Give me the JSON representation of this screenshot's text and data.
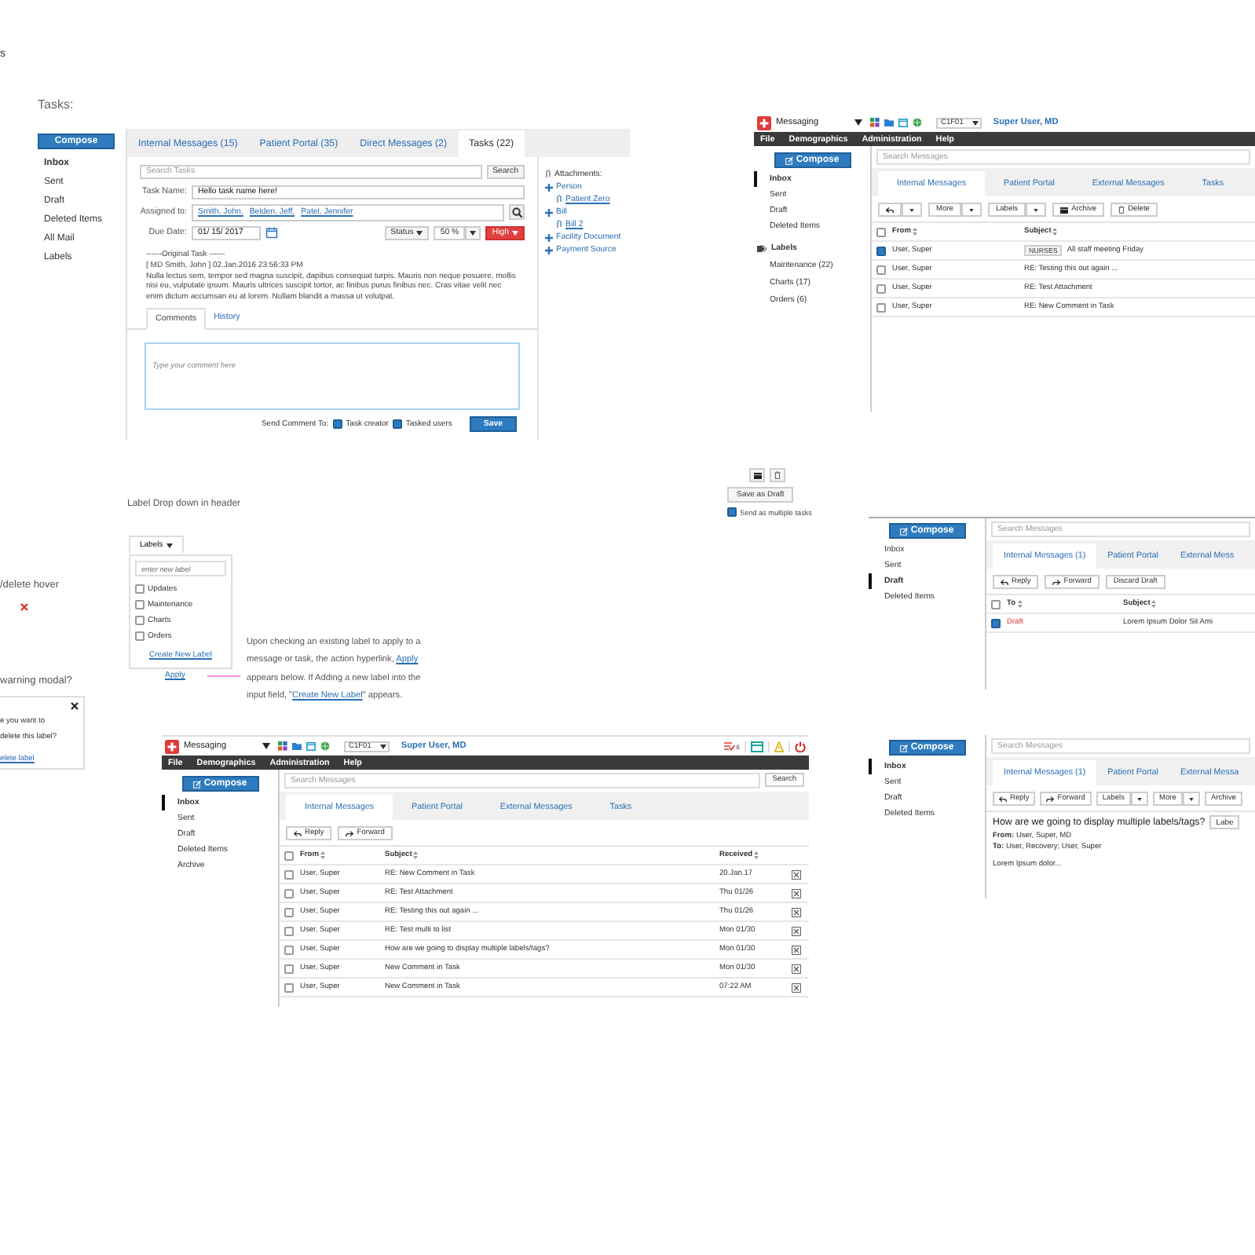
{
  "fragment_top": "s",
  "tasks": {
    "heading": "Tasks:",
    "compose": "Compose",
    "folders": [
      {
        "label": "Inbox",
        "selected": true
      },
      {
        "label": "Sent",
        "selected": false
      },
      {
        "label": "Draft",
        "selected": false
      },
      {
        "label": "Deleted Items",
        "selected": false
      },
      {
        "label": "All Mail",
        "selected": false
      },
      {
        "label": "Labels",
        "selected": false
      }
    ],
    "tabs": [
      {
        "label": "Internal Messages (15)",
        "selected": false
      },
      {
        "label": "Patient Portal (35)",
        "selected": false
      },
      {
        "label": "Direct Messages (2)",
        "selected": false
      },
      {
        "label": "Tasks (22)",
        "selected": true
      }
    ],
    "search": {
      "placeholder": "Search Tasks",
      "button": "Search"
    },
    "task_name": {
      "label": "Task Name:",
      "value": "Hello task name here!"
    },
    "assigned": {
      "label": "Assigned to:",
      "people": [
        "Smith, John,",
        "Belden, Jeff,",
        "Patel, Jennifer"
      ]
    },
    "due_date": {
      "label": "Due Date:",
      "value": "01/ 15/ 2017"
    },
    "status": "Status",
    "percent": "50 %",
    "priority": "High",
    "original": {
      "title": "------Original Task ------",
      "meta": "[ MD Smith, John ]  02.Jan.2016 23:56:33 PM",
      "body": "Nulla lectus sem, tempor sed magna suscipit, dapibus consequat turpis. Mauris non neque posuere, mollis nisi eu, vulputate ipsum. Mauris ultrices suscipit tortor, ac finibus purus finibus nec. Cras vitae velit nec enim dictum accumsan eu at lorem. Nullam blandit a massa ut volutpat."
    },
    "comment_tabs": [
      {
        "label": "Comments",
        "selected": true
      },
      {
        "label": "History",
        "selected": false
      }
    ],
    "comment": {
      "placeholder": "Type your comment here"
    },
    "send_to": {
      "label": "Send Comment To:",
      "options": [
        {
          "label": "Task creator",
          "checked": true
        },
        {
          "label": "Tasked users",
          "checked": true
        }
      ]
    },
    "save": "Save",
    "attachments": {
      "heading": "Attachments:",
      "items": [
        {
          "label": "Person",
          "children": [
            {
              "label": "Patient Zero"
            }
          ]
        },
        {
          "label": "Bill",
          "children": [
            {
              "label": "Bill 2"
            }
          ]
        },
        {
          "label": "Facility Document"
        },
        {
          "label": "Payment Source"
        }
      ]
    }
  },
  "label_dropdown": {
    "caption": "Label Drop down in header",
    "button": "Labels",
    "input": {
      "placeholder": "enter new label"
    },
    "options": [
      {
        "label": "Updates",
        "checked": false
      },
      {
        "label": "Maintenance",
        "checked": false
      },
      {
        "label": "Charts",
        "checked": false
      },
      {
        "label": "Orders",
        "checked": false
      }
    ],
    "create_link": "Create New Label",
    "apply_link": "Apply",
    "note": [
      {
        "kind": "text",
        "text": "Upon checking an existing label to apply to a message or task, the action hyperlink, "
      },
      {
        "kind": "link",
        "text": "Apply"
      },
      {
        "kind": "text",
        "text": " appears below. If Adding a new label into the input field, \""
      },
      {
        "kind": "link",
        "text": "Create New Label"
      },
      {
        "kind": "text",
        "text": "\" appears."
      }
    ]
  },
  "delete_hover": {
    "caption": "/delete hover"
  },
  "warning": {
    "caption": "warning modal?",
    "lines": [
      "e you want to",
      "delete this label?"
    ],
    "link": "elete label"
  },
  "draft_controls": {
    "save_draft": "Save as Draft",
    "multiple": {
      "label": "Send as multiple tasks",
      "checked": true
    }
  },
  "windows": [
    {
      "header": {
        "app": "Messaging",
        "clinic": "C1F01",
        "user": "Super User, MD"
      },
      "menu": [
        "File",
        "Demographics",
        "Administration",
        "Help"
      ],
      "compose": "Compose",
      "folders": [
        {
          "label": "Inbox",
          "selected": true
        },
        {
          "label": "Sent",
          "selected": false
        },
        {
          "label": "Draft",
          "selected": false
        },
        {
          "label": "Deleted Items",
          "selected": false
        }
      ],
      "labels": {
        "heading": "Labels",
        "items": [
          "Maintenance (22)",
          "Charts (17)",
          "Orders (6)"
        ]
      },
      "search": {
        "placeholder": "Search Messages"
      },
      "tabs": [
        {
          "label": "Internal Messages",
          "selected": true
        },
        {
          "label": "Patient Portal",
          "selected": false
        },
        {
          "label": "External Messages",
          "selected": false
        },
        {
          "label": "Tasks",
          "selected": false
        }
      ],
      "toolbar": [
        {
          "kind": "reply_menu"
        },
        {
          "kind": "menu",
          "label": "More"
        },
        {
          "kind": "menu",
          "label": "Labels"
        },
        {
          "kind": "archive",
          "label": "Archive"
        },
        {
          "kind": "delete",
          "label": "Delete"
        }
      ],
      "list": {
        "columns": [
          "From",
          "Subject"
        ],
        "all_checked": false,
        "rows": [
          {
            "checked": true,
            "tag": "NURSES",
            "cells": [
              "User, Super",
              "All staff meeting Friday"
            ]
          },
          {
            "checked": false,
            "cells": [
              "User, Super",
              "RE: Testing this out again ..."
            ]
          },
          {
            "checked": false,
            "cells": [
              "User, Super",
              "RE: Test Attachment"
            ]
          },
          {
            "checked": false,
            "cells": [
              "User, Super",
              "RE: New Comment in Task"
            ]
          }
        ]
      }
    },
    {
      "compose": "Compose",
      "folders": [
        {
          "label": "Inbox",
          "selected": false
        },
        {
          "label": "Sent",
          "selected": false
        },
        {
          "label": "Draft",
          "selected": true
        },
        {
          "label": "Deleted Items",
          "selected": false
        }
      ],
      "search": {
        "placeholder": "Search Messages"
      },
      "tabs": [
        {
          "label": "Internal Messages (1)",
          "selected": true
        },
        {
          "label": "Patient Portal",
          "selected": false
        },
        {
          "label": "External Mess",
          "selected": false
        }
      ],
      "toolbar": [
        {
          "kind": "reply",
          "label": "Reply"
        },
        {
          "kind": "forward",
          "label": "Forward"
        },
        {
          "kind": "plain",
          "label": "Discard Draft"
        }
      ],
      "list": {
        "columns": [
          "To",
          "Subject"
        ],
        "all_checked": false,
        "rows": [
          {
            "checked": true,
            "draft": true,
            "cells": [
              "Draft",
              "Lorem Ipsum Dolor Sit Ami"
            ]
          }
        ]
      }
    },
    {
      "header": {
        "app": "Messaging",
        "clinic": "C1F01",
        "user": "Super User, MD",
        "alerts": {
          "task_count": "6"
        }
      },
      "menu": [
        "File",
        "Demographics",
        "Administration",
        "Help"
      ],
      "compose": "Compose",
      "folders": [
        {
          "label": "Inbox",
          "selected": true
        },
        {
          "label": "Sent",
          "selected": false
        },
        {
          "label": "Draft",
          "selected": false
        },
        {
          "label": "Deleted Items",
          "selected": false
        },
        {
          "label": "Archive",
          "selected": false
        }
      ],
      "search": {
        "placeholder": "Search Messages",
        "button": "Search"
      },
      "tabs": [
        {
          "label": "Internal Messages",
          "selected": true
        },
        {
          "label": "Patient Portal",
          "selected": false
        },
        {
          "label": "External Messages",
          "selected": false
        },
        {
          "label": "Tasks",
          "selected": false
        }
      ],
      "toolbar": [
        {
          "kind": "reply",
          "label": "Reply"
        },
        {
          "kind": "forward",
          "label": "Forward"
        }
      ],
      "list": {
        "columns": [
          "From",
          "Subject",
          "Received"
        ],
        "all_checked": false,
        "row_delete": true,
        "rows": [
          {
            "checked": false,
            "cells": [
              "User, Super",
              "RE: New Comment in Task",
              "20.Jan.17"
            ]
          },
          {
            "checked": false,
            "cells": [
              "User, Super",
              "RE: Test Attachment",
              "Thu 01/26"
            ]
          },
          {
            "checked": false,
            "cells": [
              "User, Super",
              "RE: Testing this out again ...",
              "Thu 01/26"
            ]
          },
          {
            "checked": false,
            "cells": [
              "User, Super",
              "RE: Test multi to list",
              "Mon 01/30"
            ]
          },
          {
            "checked": false,
            "cells": [
              "User, Super",
              "How are we going to display multiple labels/tags?",
              "Mon 01/30"
            ]
          },
          {
            "checked": false,
            "cells": [
              "User, Super",
              "New Comment in Task",
              "Mon 01/30"
            ]
          },
          {
            "checked": false,
            "cells": [
              "User, Super",
              "New Comment in Task",
              "07:22 AM"
            ]
          }
        ]
      }
    },
    {
      "compose": "Compose",
      "folders": [
        {
          "label": "Inbox",
          "selected": true
        },
        {
          "label": "Sent",
          "selected": false
        },
        {
          "label": "Draft",
          "selected": false
        },
        {
          "label": "Deleted Items",
          "selected": false
        }
      ],
      "search": {
        "placeholder": "Search Messages"
      },
      "tabs": [
        {
          "label": "Internal Messages (1)",
          "selected": true
        },
        {
          "label": "Patient Portal",
          "selected": false
        },
        {
          "label": "External Messa",
          "selected": false
        }
      ],
      "toolbar": [
        {
          "kind": "reply",
          "label": "Reply"
        },
        {
          "kind": "forward",
          "label": "Forward"
        },
        {
          "kind": "menu",
          "label": "Labels"
        },
        {
          "kind": "menu",
          "label": "More"
        },
        {
          "kind": "plain",
          "label": "Archive"
        }
      ],
      "message": {
        "subject": "How are we going to display multiple labels/tags?",
        "labels_button": "Labe",
        "from_label": "From:",
        "from": "User, Super, MD",
        "to_label": "To:",
        "to": "User, Recovery; User, Super",
        "body": "Lorem Ipsum dolor..."
      }
    }
  ]
}
